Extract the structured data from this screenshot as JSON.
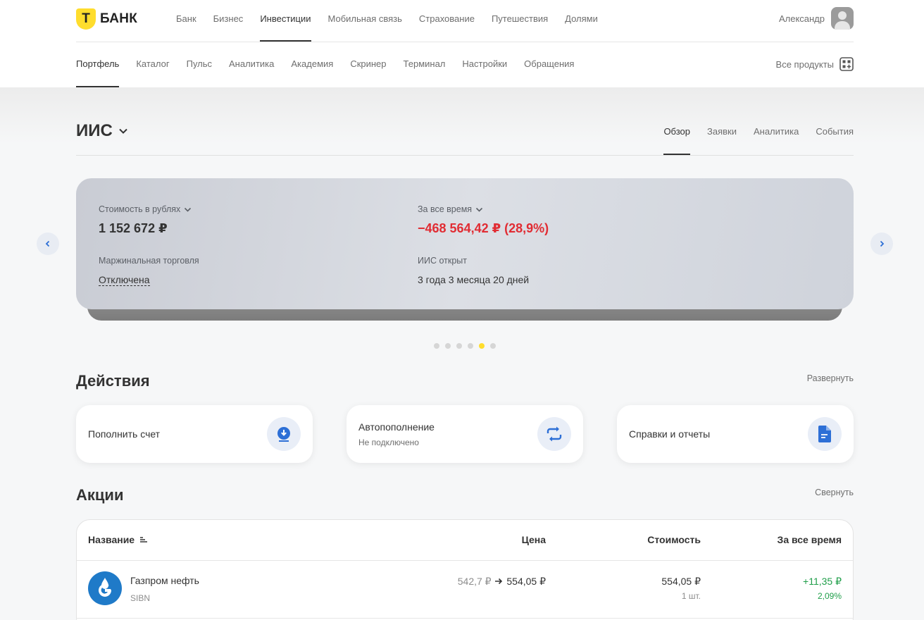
{
  "brand": {
    "letter": "Т",
    "name": "БАНК"
  },
  "top_nav": [
    "Банк",
    "Бизнес",
    "Инвестиции",
    "Мобильная связь",
    "Страхование",
    "Путешествия",
    "Долями"
  ],
  "top_nav_active": 2,
  "user": {
    "name": "Александр"
  },
  "sub_nav": [
    "Портфель",
    "Каталог",
    "Пульс",
    "Аналитика",
    "Академия",
    "Скринер",
    "Терминал",
    "Настройки",
    "Обращения"
  ],
  "sub_nav_active": 0,
  "all_products": "Все продукты",
  "account": {
    "title": "ИИС",
    "tabs": [
      "Обзор",
      "Заявки",
      "Аналитика",
      "События"
    ],
    "active_tab": 0
  },
  "summary": {
    "value_label": "Стоимость в рублях",
    "value": "1 152 672 ₽",
    "alltime_label": "За все время",
    "alltime_value": "−468 564,42 ₽ (28,9%)",
    "margin_label": "Маржинальная торговля",
    "margin_value": "Отключена",
    "opened_label": "ИИС открыт",
    "opened_value": "3 года 3 месяца 20 дней"
  },
  "carousel": {
    "count": 6,
    "active": 4
  },
  "actions_section": {
    "title": "Действия",
    "toggle": "Развернуть",
    "items": [
      {
        "title": "Пополнить счет",
        "subtitle": "",
        "icon": "download-icon"
      },
      {
        "title": "Автопополнение",
        "subtitle": "Не подключено",
        "icon": "repeat-icon"
      },
      {
        "title": "Справки и отчеты",
        "subtitle": "",
        "icon": "document-icon"
      }
    ]
  },
  "stocks_section": {
    "title": "Акции",
    "toggle": "Свернуть",
    "columns": [
      "Название",
      "Цена",
      "Стоимость",
      "За все время"
    ],
    "rows": [
      {
        "name": "Газпром нефть",
        "ticker": "SIBN",
        "price_from": "542,7 ₽",
        "price_to": "554,05 ₽",
        "value": "554,05 ₽",
        "qty": "1 шт.",
        "change": "+11,35 ₽",
        "change_pct": "2,09%"
      }
    ]
  },
  "colors": {
    "accent": "#ffdd2d",
    "negative": "#e12c33",
    "positive": "#1f9e49",
    "icon_blue": "#2d6fd6"
  }
}
